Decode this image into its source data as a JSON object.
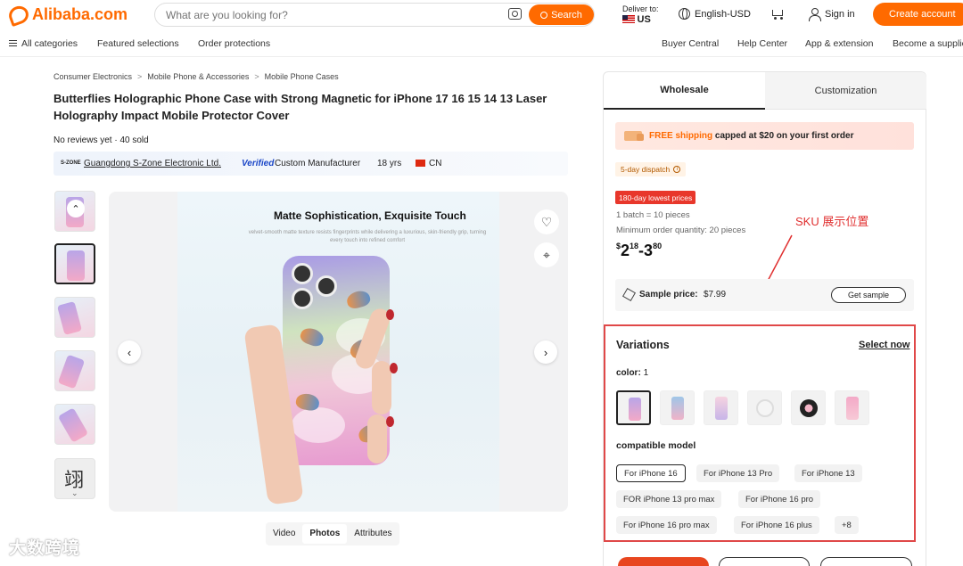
{
  "header": {
    "logo_text": "Alibaba.com",
    "search_placeholder": "What are you looking for?",
    "search_button": "Search",
    "deliver_label": "Deliver to:",
    "deliver_country": "US",
    "language_currency": "English-USD",
    "sign_in": "Sign in",
    "create_account": "Create account",
    "accent_color": "#ff6a00"
  },
  "nav": {
    "all_categories": "All categories",
    "featured": "Featured selections",
    "protection": "Order protections",
    "buyer_central": "Buyer Central",
    "help_center": "Help Center",
    "app_extension": "App & extension",
    "become_supplier": "Become a supplie"
  },
  "breadcrumb": [
    "Consumer Electronics",
    "Mobile Phone & Accessories",
    "Mobile Phone Cases"
  ],
  "product": {
    "title": "Butterflies Holographic Phone Case with Strong Magnetic for iPhone 17 16 15 14 13 Laser Holography Impact Mobile Protector Cover",
    "reviews": "No reviews yet · 40 sold"
  },
  "supplier": {
    "logo_text": "S-ZONE",
    "name": "Guangdong S-Zone Electronic Ltd.",
    "verified": "Verified",
    "type": "Custom Manufacturer",
    "years": "18 yrs",
    "country": "CN"
  },
  "image": {
    "headline": "Matte Sophistication, Exquisite Touch",
    "subline": "velvet-smooth matte texture resists fingerprints while delivering a luxurious, skin-friendly grip, turning every touch into refined comfort",
    "thumb_glyph": "翊"
  },
  "media_tabs": [
    "Video",
    "Photos",
    "Attributes"
  ],
  "watermark": "大数跨境",
  "purchase": {
    "tabs": [
      "Wholesale",
      "Customization"
    ],
    "shipping_prefix": "FREE shipping",
    "shipping_suffix": "capped at $20 on your first order",
    "dispatch": "5-day dispatch",
    "lowest_badge": "180-day lowest prices",
    "batch": "1 batch = 10 pieces",
    "min_order": "Minimum order quantity: 20 pieces",
    "price_low_int": "2",
    "price_low_dec": "18",
    "price_high_int": "3",
    "price_high_dec": "80",
    "sample_label": "Sample price:",
    "sample_value": "$7.99",
    "get_sample": "Get sample",
    "annotation": "SKU 展示位置"
  },
  "variations": {
    "title": "Variations",
    "select_now": "Select now",
    "color_label": "color:",
    "color_count": "1",
    "model_label": "compatible model",
    "models": [
      "For iPhone 16",
      "For iPhone 13 Pro",
      "For iPhone 13",
      "FOR iPhone 13 pro max",
      "For iPhone 16 pro",
      "For iPhone 16 pro max",
      "For iPhone 16 plus",
      "+8"
    ]
  }
}
